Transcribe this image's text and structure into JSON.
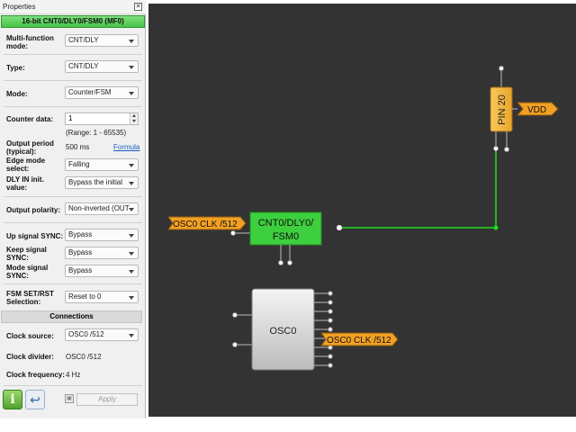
{
  "panel": {
    "title": "Properties",
    "close_glyph": "✕",
    "block_title": "16-bit CNT0/DLY0/FSM0 (MF0)",
    "fields": {
      "multi_function_mode": {
        "label_line1": "Multi-function",
        "label_line2": "mode:",
        "value": "CNT/DLY"
      },
      "type": {
        "label": "Type:",
        "value": "CNT/DLY"
      },
      "mode": {
        "label": "Mode:",
        "value": "Counter/FSM"
      },
      "counter_data": {
        "label": "Counter data:",
        "value": "1",
        "range": "(Range:  1 - 65535)"
      },
      "output_period": {
        "label_line1": "Output period",
        "label_line2": "(typical):",
        "value": "500 ms",
        "link": "Formula"
      },
      "edge_mode": {
        "label_line1": "Edge mode",
        "label_line2": "select:",
        "value": "Falling"
      },
      "dly_in_init": {
        "label_line1": "DLY IN init.",
        "label_line2": "value:",
        "value": "Bypass the initial"
      },
      "output_polarity": {
        "label": "Output polarity:",
        "value": "Non-inverted (OUT"
      },
      "up_signal_sync": {
        "label": "Up signal SYNC:",
        "value": "Bypass"
      },
      "keep_signal_sync": {
        "label_line1": "Keep signal",
        "label_line2": "SYNC:",
        "value": "Bypass"
      },
      "mode_signal_sync": {
        "label_line1": "Mode signal",
        "label_line2": "SYNC:",
        "value": "Bypass"
      },
      "fsm_set_rst": {
        "label_line1": "FSM SET/RST",
        "label_line2": "Selection:",
        "value": "Reset to 0"
      }
    },
    "connections": {
      "header": "Connections",
      "clock_source": {
        "label": "Clock source:",
        "value": "OSC0 /512"
      },
      "clock_divider": {
        "label": "Clock divider:",
        "value": "OSC0 /512"
      },
      "clock_frequency": {
        "label": "Clock frequency:",
        "value": "4 Hz"
      }
    },
    "buttons": {
      "info_glyph": "i",
      "undo_glyph": "↩",
      "apply_label": "Apply"
    }
  },
  "canvas": {
    "background": "#333333",
    "wire_color": "#22dd22",
    "cnt_block": {
      "line1": "CNT0/DLY0/",
      "line2": "FSM0",
      "color": "#3ecf3e"
    },
    "osc_block": {
      "label": "OSC0"
    },
    "input_tag": {
      "text": "OSC0 CLK /512",
      "color": "#f2a024"
    },
    "output_tag": {
      "text": "OSC0 CLK /512",
      "color": "#f2a024"
    },
    "pin": {
      "label": "PIN 20",
      "color": "#f5b43a"
    },
    "vdd_tag": {
      "text": "VDD",
      "color": "#f2a024"
    }
  }
}
